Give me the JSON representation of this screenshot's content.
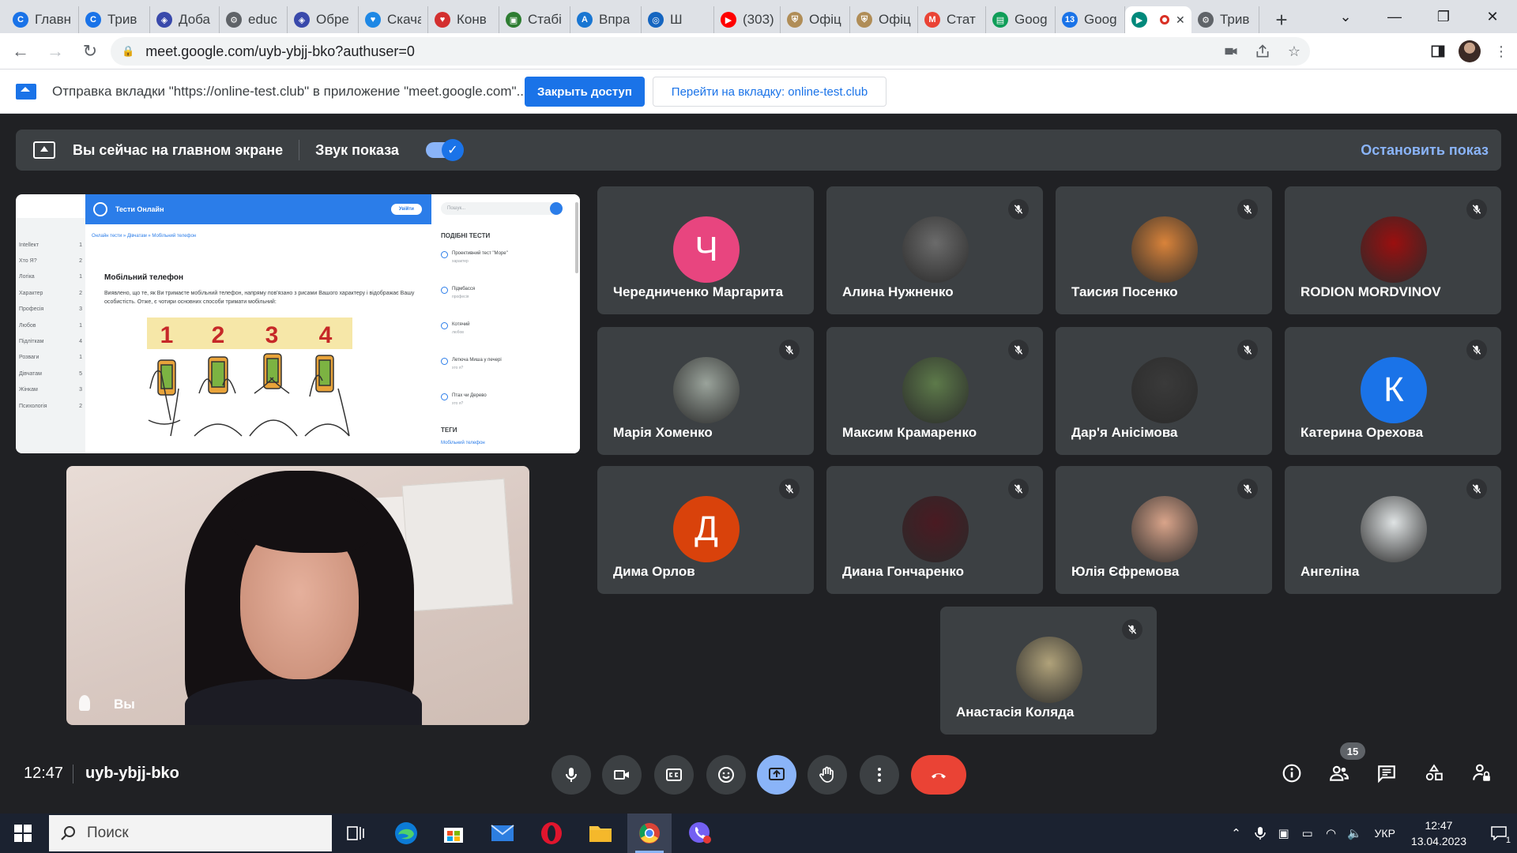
{
  "browser": {
    "tabs": [
      {
        "title": "Главн",
        "color": "#1a73e8",
        "glyph": "C"
      },
      {
        "title": "Трив",
        "color": "#1a73e8",
        "glyph": "C"
      },
      {
        "title": "Доба",
        "color": "#3949ab",
        "glyph": "◈"
      },
      {
        "title": "educ",
        "color": "#5f6368",
        "glyph": "⚙"
      },
      {
        "title": "Обре",
        "color": "#3949ab",
        "glyph": "◈"
      },
      {
        "title": "Скача",
        "color": "#1e88e5",
        "glyph": "♥"
      },
      {
        "title": "Конв",
        "color": "#d32f2f",
        "glyph": "♥"
      },
      {
        "title": "Стабі",
        "color": "#2e7d32",
        "glyph": "▣"
      },
      {
        "title": "Впра",
        "color": "#1976d2",
        "glyph": "A"
      },
      {
        "title": "Ш",
        "color": "#1565c0",
        "glyph": "◎"
      },
      {
        "title": "(303)",
        "color": "#ff0000",
        "glyph": "▶"
      },
      {
        "title": "Офіц",
        "color": "#b08d57",
        "glyph": "⛨"
      },
      {
        "title": "Офіц",
        "color": "#b08d57",
        "glyph": "⛨"
      },
      {
        "title": "Стат",
        "color": "#ea4335",
        "glyph": "M"
      },
      {
        "title": "Goog",
        "color": "#0f9d58",
        "glyph": "▤"
      },
      {
        "title": "Goog",
        "color": "#1a73e8",
        "glyph": "13"
      },
      {
        "title": "",
        "color": "#00897b",
        "glyph": "▶",
        "active": true
      },
      {
        "title": "Трив",
        "color": "#5f6368",
        "glyph": "⚙"
      }
    ],
    "new_tab": "+",
    "url": "meet.google.com/uyb-ybjj-bko?authuser=0"
  },
  "sharebar": {
    "text": "Отправка вкладки \"https://online-test.club\" в приложение \"meet.google.com\"...",
    "stop_access": "Закрыть доступ",
    "switch_tab": "Перейти на вкладку: online-test.club"
  },
  "present_bar": {
    "status": "Вы сейчас на главном экране",
    "sound_label": "Звук показа",
    "sound_on": true,
    "stop": "Остановить показ"
  },
  "presentation": {
    "site_name": "Тести Онлайн",
    "login": "Увійти",
    "breadcrumb": "Онлайн тести » Дівчатам » Мобільний телефон",
    "title": "Мобільний телефон",
    "description": "Виявлено, що те, як Ви тримаєте мобільний телефон, напряму пов'язано з рисами Вашого характеру і відображає Вашу особистість. Отже, є чотири основних способи тримати мобільний:",
    "numbers": [
      "1",
      "2",
      "3",
      "4"
    ],
    "search_placeholder": "Пошук...",
    "sidebar": [
      {
        "label": "Іntellект",
        "count": "1"
      },
      {
        "label": "Хто Я?",
        "count": "2"
      },
      {
        "label": "Логіка",
        "count": "1"
      },
      {
        "label": "Характер",
        "count": "2"
      },
      {
        "label": "Професія",
        "count": "3"
      },
      {
        "label": "Любов",
        "count": "1"
      },
      {
        "label": "Підліткам",
        "count": "4"
      },
      {
        "label": "Розваги",
        "count": "1"
      },
      {
        "label": "Дівчатам",
        "count": "5"
      },
      {
        "label": "Жінкам",
        "count": "3"
      },
      {
        "label": "Психологія",
        "count": "2"
      }
    ],
    "related_heading": "ПОДІБНІ ТЕСТИ",
    "related": [
      {
        "title": "Проективний тест \"Море\"",
        "sub": "характер"
      },
      {
        "title": "Підмбасся",
        "sub": "професія"
      },
      {
        "title": "Котячий",
        "sub": "любов"
      },
      {
        "title": "Летюча Миша у печері",
        "sub": "хто я?"
      },
      {
        "title": "Птах чи Дерево",
        "sub": "хто я?"
      }
    ],
    "tags_heading": "ТЕГИ",
    "tag": "Мобільний телефон"
  },
  "self_tile": {
    "name": "Вы"
  },
  "participants": [
    {
      "name": "Чередниченко Маргарита",
      "initial": "Ч",
      "color": "#e8457f",
      "muted": false
    },
    {
      "name": "Алина Нужненко",
      "initial": "",
      "color": "#6b6b6b",
      "muted": true
    },
    {
      "name": "Таисия Посенко",
      "initial": "",
      "color": "#d9833a",
      "muted": true
    },
    {
      "name": "RODION MORDVINOV",
      "initial": "",
      "color": "#9b0f0f",
      "muted": true
    },
    {
      "name": "Марія Хоменко",
      "initial": "",
      "color": "#9aa39b",
      "muted": true
    },
    {
      "name": "Максим Крамаренко",
      "initial": "",
      "color": "#5d7a4a",
      "muted": true
    },
    {
      "name": "Дар'я Анісімова",
      "initial": "",
      "color": "#3a3a3a",
      "muted": true
    },
    {
      "name": "Катерина Орехова",
      "initial": "К",
      "color": "#1a73e8",
      "muted": true
    },
    {
      "name": "Дима Орлов",
      "initial": "Д",
      "color": "#d9420b",
      "muted": true
    },
    {
      "name": "Диана Гончаренко",
      "initial": "",
      "color": "#4a1a22",
      "muted": true
    },
    {
      "name": "Юлія Єфремова",
      "initial": "",
      "color": "#d9a48a",
      "muted": true
    },
    {
      "name": "Ангеліна",
      "initial": "",
      "color": "#dfe3e4",
      "muted": true
    },
    {
      "name": "Анастасія Коляда",
      "initial": "",
      "color": "#b0a27a",
      "muted": true
    }
  ],
  "meeting": {
    "time": "12:47",
    "code": "uyb-ybjj-bko",
    "people_count": "15"
  },
  "taskbar": {
    "search_placeholder": "Поиск",
    "language": "УКР",
    "time": "12:47",
    "date": "13.04.2023",
    "notifications": "1"
  }
}
